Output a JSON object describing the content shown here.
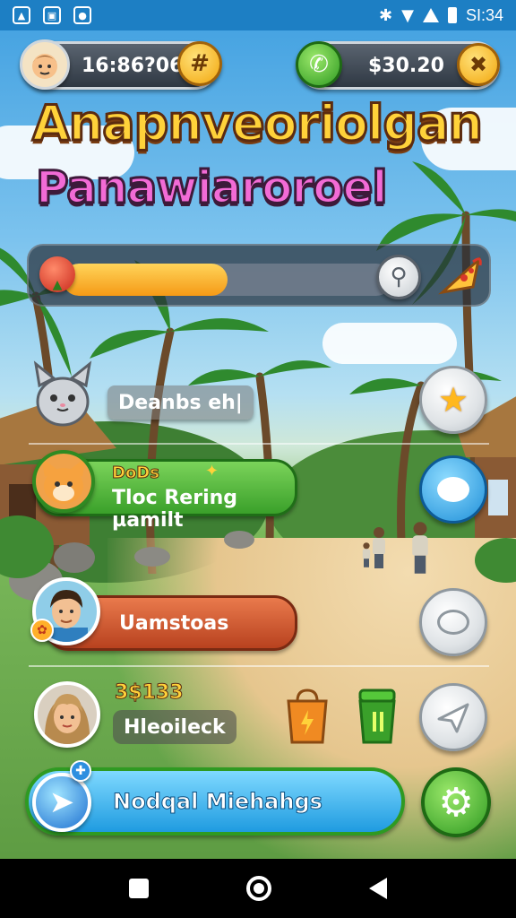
{
  "status_bar": {
    "time": "SI:34"
  },
  "top": {
    "coins_value": "16:86?06",
    "cash_value": "$30.20"
  },
  "title": {
    "line1": "Anapnveoriolgan",
    "line2": "Panawiaroroel"
  },
  "progress": {
    "level": 0.5
  },
  "rows": [
    {
      "label": "Deanbs eh|"
    },
    {
      "tag": "DoDs",
      "label": "Tloc Rering µamilt"
    },
    {
      "label": "Uamstoas"
    },
    {
      "score": "3$133",
      "label": "Hleoileck"
    }
  ],
  "bottom": {
    "main_button_label": "Nodqal Miehahgs"
  },
  "colors": {
    "status_bar": "#1d7fc4",
    "green_pill": "#4fb53a",
    "orange_pill": "#d9562e",
    "blue_button": "#36b7e8",
    "gold": "#ffc21f"
  }
}
